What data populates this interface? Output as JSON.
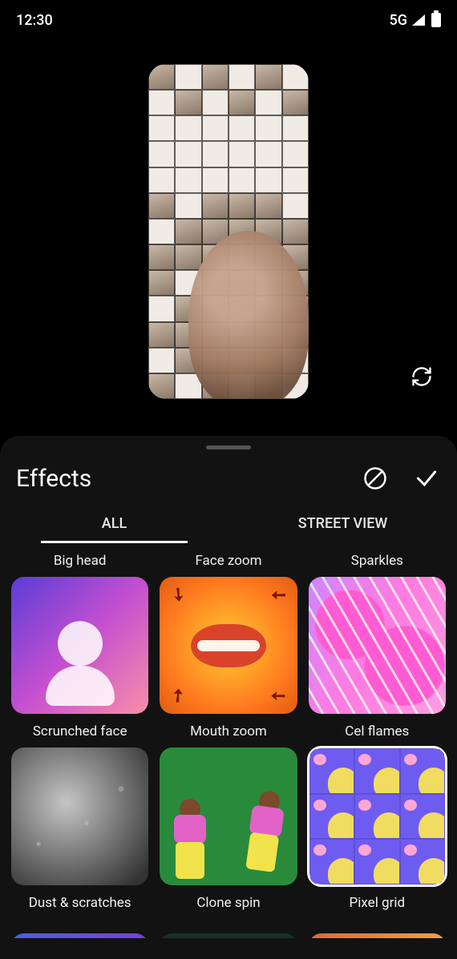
{
  "status": {
    "time": "12:30",
    "network": "5G"
  },
  "panel": {
    "title": "Effects",
    "tabs": {
      "all": "ALL",
      "street": "STREET VIEW"
    }
  },
  "effects": {
    "row0": [
      "Big head",
      "Face zoom",
      "Sparkles"
    ],
    "row1": [
      "Scrunched face",
      "Mouth zoom",
      "Cel flames"
    ],
    "row2": [
      "Dust & scratches",
      "Clone spin",
      "Pixel grid"
    ]
  },
  "selected_effect": "Pixel grid"
}
